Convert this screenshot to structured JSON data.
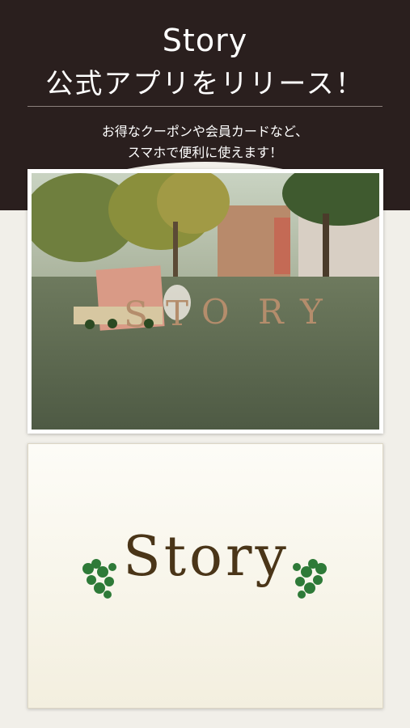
{
  "header": {
    "title_en": "Story",
    "title_jp": "公式アプリをリリース！",
    "subtitle_line1": "お得なクーポンや会員カードなど、",
    "subtitle_line2": "スマホで便利に使えます！"
  },
  "logo": {
    "word": "Story",
    "leaf_icon": "ivy-leaf-icon"
  },
  "colors": {
    "header_bg": "#2a1f1e",
    "page_bg": "#f1efe9",
    "logo_text": "#4a3518",
    "leaf": "#2e7a38"
  }
}
